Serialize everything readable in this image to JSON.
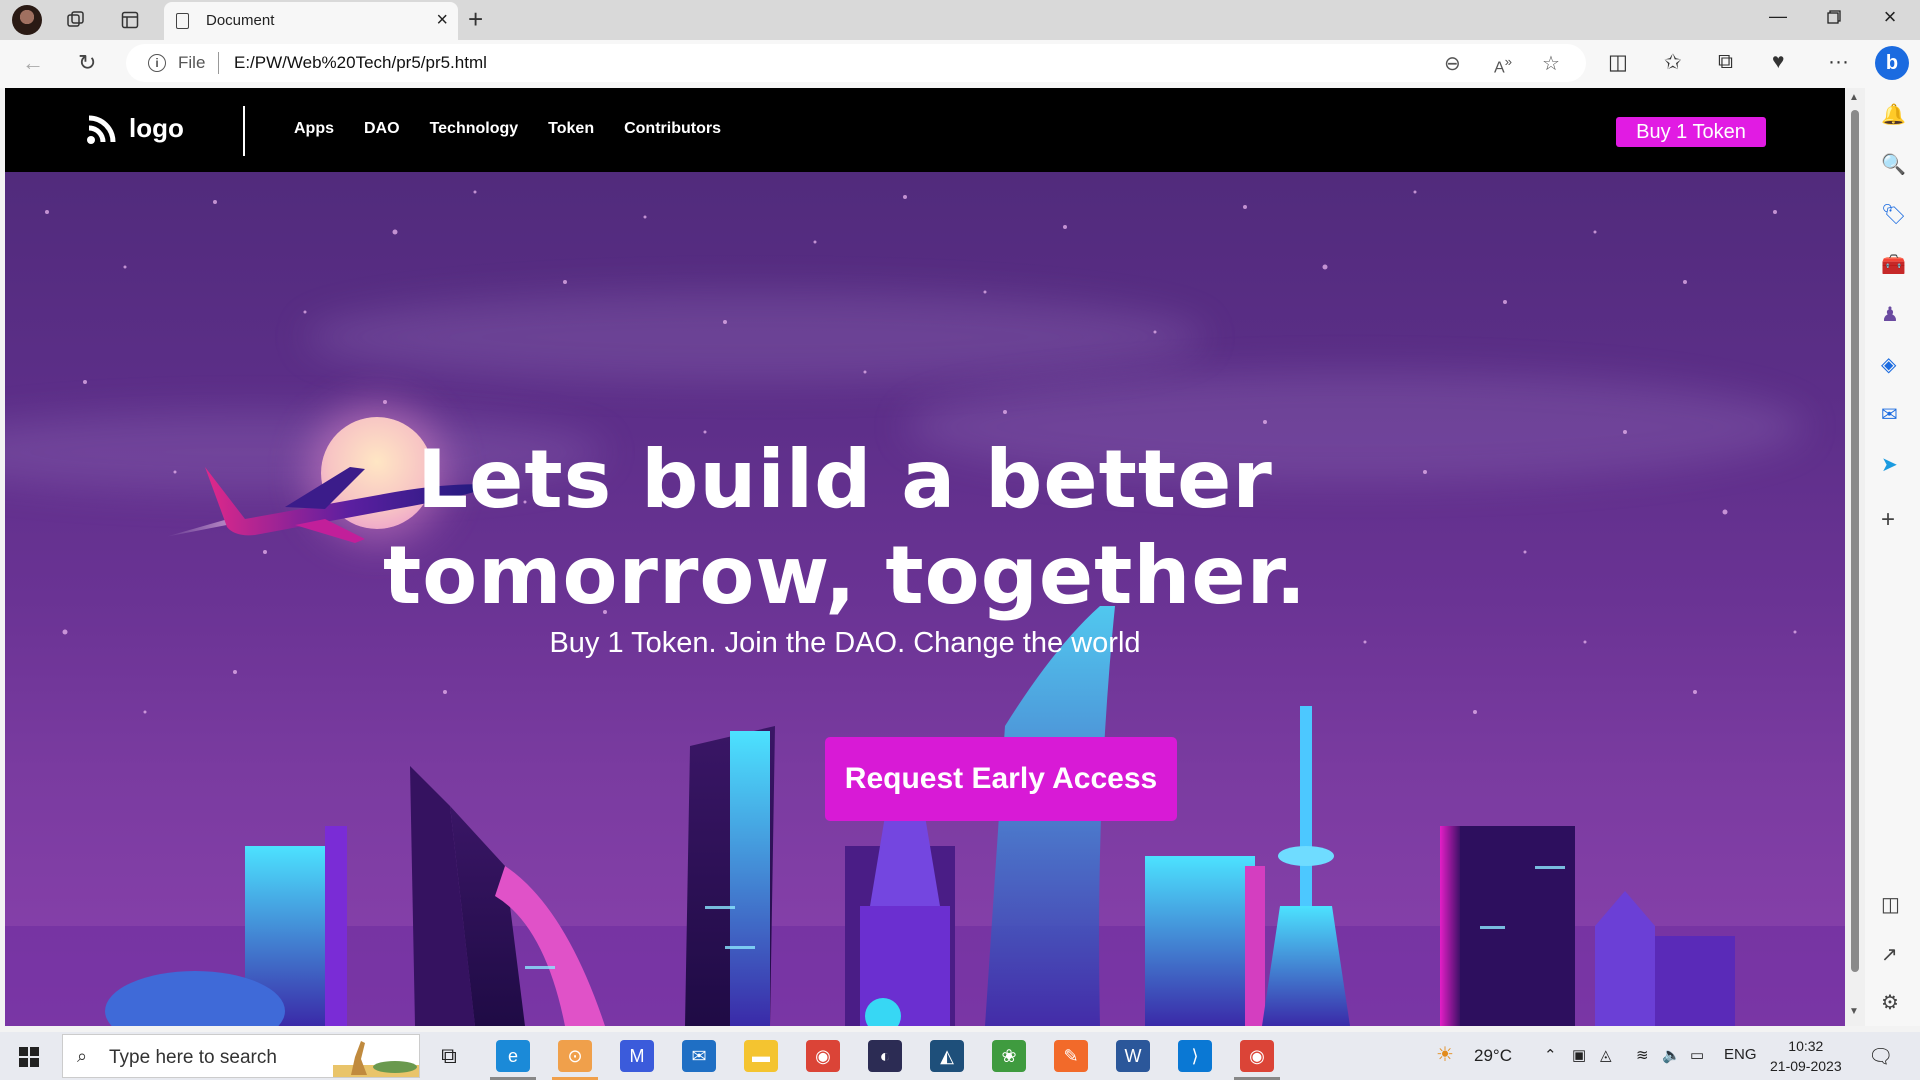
{
  "browser": {
    "tab_title": "Document",
    "file_label": "File",
    "url": "E:/PW/Web%20Tech/pr5/pr5.html"
  },
  "site": {
    "logo_text": "logo",
    "nav_items": [
      "Apps",
      "DAO",
      "Technology",
      "Token",
      "Contributors"
    ],
    "buy_button": "Buy 1 Token",
    "headline_line1": "Lets build a better",
    "headline_line2": "tomorrow, together.",
    "subline": "Buy 1 Token. Join the DAO. Change the world",
    "cta_button": "Request Early Access",
    "accent_color": "#e11be3"
  },
  "taskbar": {
    "search_placeholder": "Type here to search",
    "temperature": "29°C",
    "language": "ENG",
    "time": "10:32",
    "date": "21-09-2023"
  }
}
